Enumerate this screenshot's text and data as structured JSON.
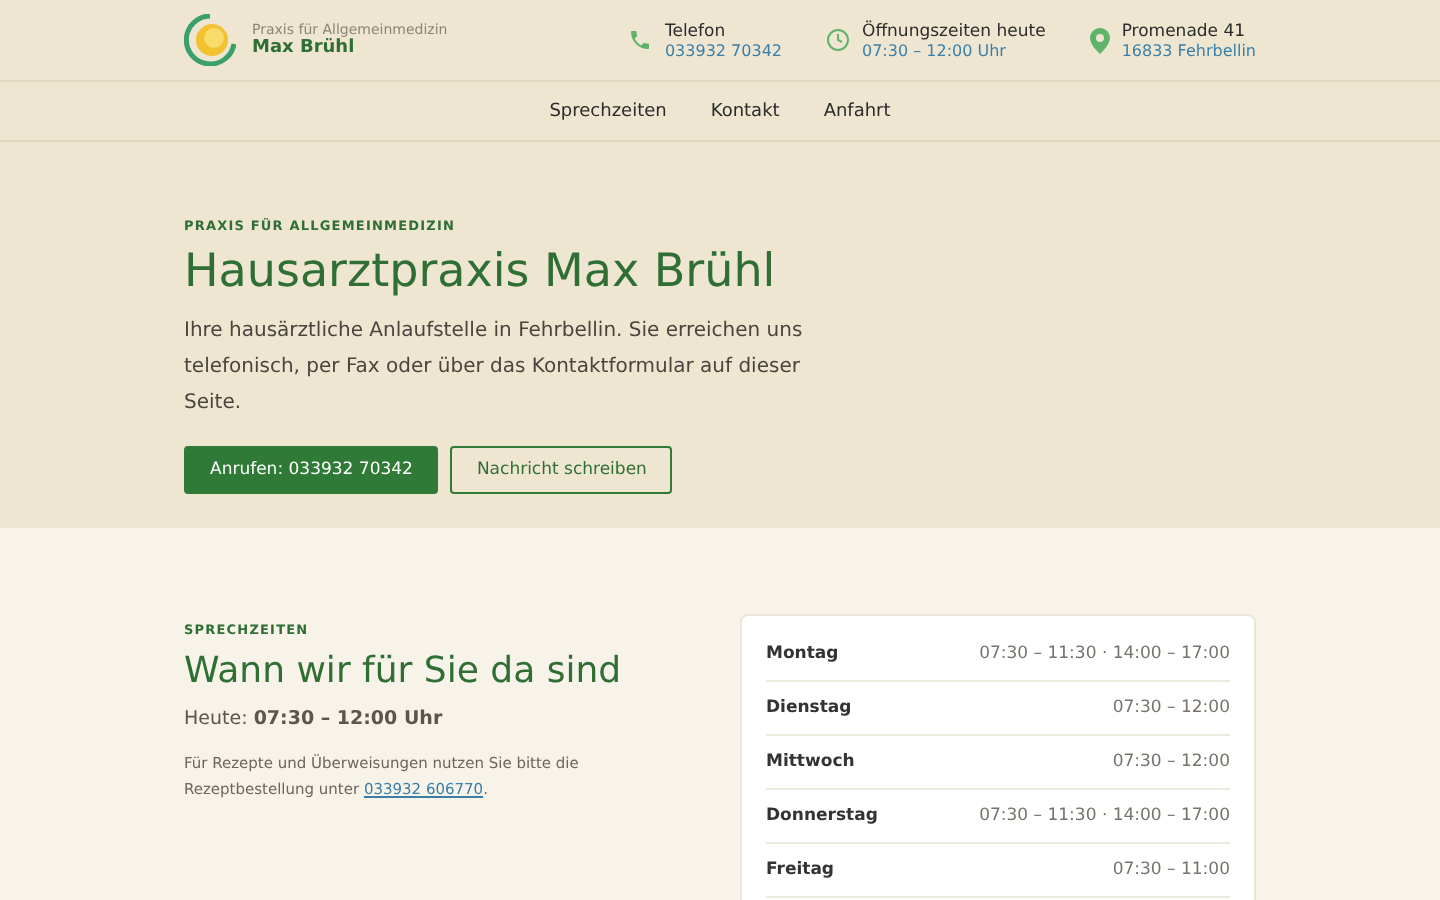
{
  "header": {
    "logo": {
      "tagline": "Praxis für Allgemeinmedizin",
      "name": "Max Brühl"
    },
    "contacts": [
      {
        "kind": "phone",
        "label": "Telefon",
        "value": "033932 70342"
      },
      {
        "kind": "clock",
        "label": "Öffnungszeiten heute",
        "value": "07:30 – 12:00 Uhr"
      },
      {
        "kind": "pin",
        "label": "Promenade 41",
        "value": "16833 Fehrbellin"
      }
    ]
  },
  "nav": [
    "Sprechzeiten",
    "Kontakt",
    "Anfahrt"
  ],
  "hero": {
    "kicker": "PRAXIS FÜR ALLGEMEINMEDIZIN",
    "title": "Hausarztpraxis Max Brühl",
    "text": "Ihre hausärztliche Anlaufstelle in Fehrbellin. Sie erreichen uns telefonisch, per Fax oder über das Kontaktformular auf dieser Seite.",
    "buttons": [
      {
        "kind": "primary",
        "label": "Anrufen: 033932 70342"
      },
      {
        "kind": "outline",
        "label": "Nachricht schreiben"
      }
    ]
  },
  "hours": {
    "kicker": "SPRECHZEITEN",
    "title": "Wann wir für Sie da sind",
    "today": "Heute: **07:30 – 12:00 Uhr**",
    "note": "Für Rezepte und Überweisungen nutzen Sie bitte die Rezeptbestellung unter",
    "note_link": "033932 606770",
    "note_end": ".",
    "rows": [
      {
        "day": "Montag",
        "time": "07:30 – 11:30 · 14:00 – 17:00"
      },
      {
        "day": "Dienstag",
        "time": "07:30 – 12:00"
      },
      {
        "day": "Mittwoch",
        "time": "07:30 – 12:00"
      },
      {
        "day": "Donnerstag",
        "time": "07:30 – 11:30 · 14:00 – 17:00"
      },
      {
        "day": "Freitag",
        "time": "07:30 – 11:00"
      }
    ]
  }
}
